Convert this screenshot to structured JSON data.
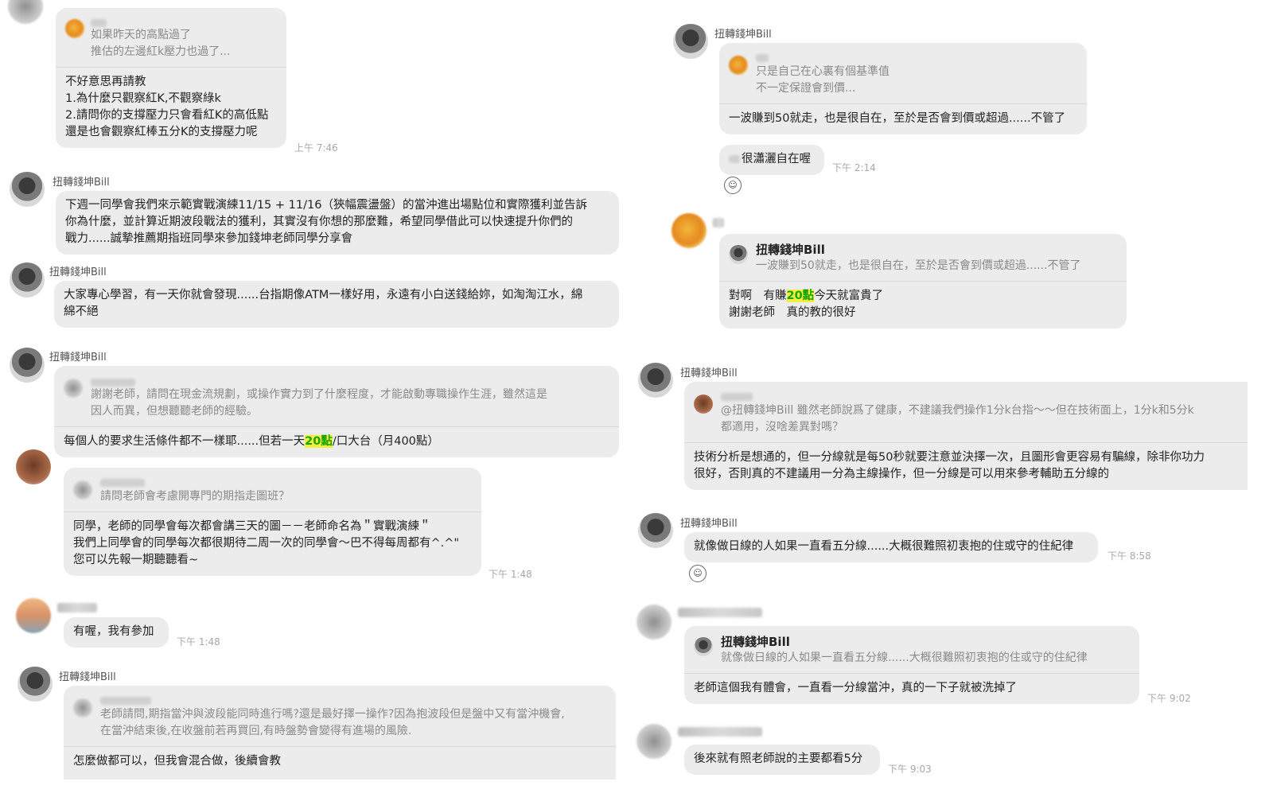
{
  "m1": {
    "quote": [
      "如果昨天的高點過了",
      "推估的左邊紅k壓力也過了..."
    ],
    "body": [
      "不好意思再請教",
      "1.為什麼只觀察紅K,不觀察綠k",
      "2.請問你的支撐壓力只會看紅K的高低點",
      "還是也會觀察紅棒五分K的支撐壓力呢"
    ],
    "time": "上午 7:46"
  },
  "m2": {
    "sender": "扭轉錢坤Bill",
    "body": [
      "下週一同學會我們來示範實戰演練11/15 + 11/16（狹幅震盪盤）的當沖進出場點位和實際獲利並告訴",
      "你為什麼，並計算近期波段戰法的獲利，其實沒有你想的那麼難，希望同學借此可以快速提升你們的",
      "戰力......誠摯推薦期指班同學來參加錢坤老師同學分享會"
    ]
  },
  "m3": {
    "sender": "扭轉錢坤Bill",
    "body": [
      "大家專心學習，有一天你就會發現......台指期像ATM一樣好用，永遠有小白送錢給妳，如淘淘江水，綿",
      "綿不絕"
    ]
  },
  "m4": {
    "sender": "扭轉錢坤Bill",
    "quote": [
      "謝謝老師，請問在現金流規劃，或操作實力到了什麼程度，才能啟動專職操作生涯，雖然這是",
      "因人而異，但想聽聽老師的經驗。"
    ],
    "body_pre": "每個人的要求生活條件都不一樣耶......但若一天",
    "body_hl": "20點",
    "body_post": "/口大台（月400點）"
  },
  "m5": {
    "quote": [
      "請問老師會考慮開專門的期指走圖班？"
    ],
    "body": [
      "同學，老師的同學會每次都會講三天的圖－－老師命名為＂實戰演練＂",
      "我們上同學會的同學每次都很期待二周一次的同學會～巴不得每周都有^.^\"",
      "您可以先報一期聽聽看~"
    ],
    "time": "下午 1:48"
  },
  "m6": {
    "body": [
      "有喔，我有參加"
    ],
    "time": "下午 1:48"
  },
  "m7": {
    "sender": "扭轉錢坤Bill",
    "quote": [
      "老師請問,期指當沖與波段能同時進行嗎?還是最好擇一操作?因為抱波段但是盤中又有當沖機會,",
      "在當沖結束後,在收盤前若再買回,有時盤勢會變得有進場的風險."
    ],
    "body": [
      "怎麼做都可以，但我會混合做，後續會教"
    ]
  },
  "r1": {
    "sender": "扭轉錢坤Bill",
    "quote": [
      "只是自己在心裏有個基準值",
      "不一定保證會到價..."
    ],
    "body": [
      "一波賺到50就走，也是很自在，至於是否會到價或超過......不管了"
    ]
  },
  "r2": {
    "body": [
      "很瀟灑自在喔"
    ],
    "time": "下午 2:14",
    "reaction": "☺"
  },
  "r3": {
    "quote_title": "扭轉錢坤Bill",
    "quote": [
      "一波賺到50就走，也是很自在，至於是否會到價或超過......不管了"
    ],
    "body1_pre": "對啊　有賺",
    "body1_hl": "20點",
    "body1_post": "今天就富貴了",
    "body2": "謝謝老師　真的教的很好"
  },
  "r4": {
    "sender": "扭轉錢坤Bill",
    "quote": [
      "@扭轉錢坤Bill 雖然老師說爲了健康，不建議我們操作1分k台指～～但在技術面上，1分k和5分k",
      "都適用，沒啥差異對嗎？"
    ],
    "body": [
      "技術分析是想通的，但一分線就是每50秒就要注意並決擇一次，且圖形會更容易有騙線，除非你功力",
      "很好，否則真的不建議用一分為主線操作，但一分線是可以用來參考輔助五分線的"
    ]
  },
  "r5": {
    "sender": "扭轉錢坤Bill",
    "body": [
      "就像做日線的人如果一直看五分線......大概很難照初衷抱的住或守的住紀律"
    ],
    "time": "下午 8:58",
    "reaction": "☺"
  },
  "r6": {
    "quote_title": "扭轉錢坤Bill",
    "quote": [
      "就像做日線的人如果一直看五分線......大概很難照初衷抱的住或守的住紀律"
    ],
    "body": [
      "老師這個我有體會，一直看一分線當沖，真的一下子就被洗掉了"
    ],
    "time": "下午 9:02"
  },
  "r7": {
    "body": [
      "後來就有照老師說的主要都看5分"
    ],
    "time": "下午 9:03"
  }
}
